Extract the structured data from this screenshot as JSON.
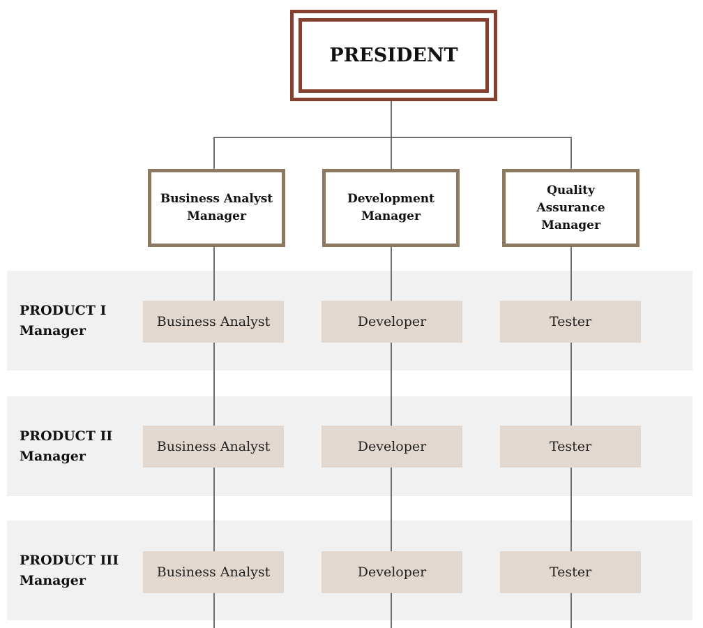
{
  "president": "PRESIDENT",
  "managers": [
    "Business Analyst Manager",
    "Development Manager",
    "Quality Assurance Manager"
  ],
  "products": [
    {
      "label_line1": "PRODUCT I",
      "label_line2": "Manager",
      "roles": [
        "Business Analyst",
        "Developer",
        "Tester"
      ]
    },
    {
      "label_line1": "PRODUCT II",
      "label_line2": "Manager",
      "roles": [
        "Business Analyst",
        "Developer",
        "Tester"
      ]
    },
    {
      "label_line1": "PRODUCT III",
      "label_line2": "Manager",
      "roles": [
        "Business Analyst",
        "Developer",
        "Tester"
      ]
    }
  ],
  "colors": {
    "president_border": "#85402f",
    "manager_border": "#8b7a60",
    "role_fill": "#e3d8d0",
    "band_fill": "#f1f1f1"
  }
}
